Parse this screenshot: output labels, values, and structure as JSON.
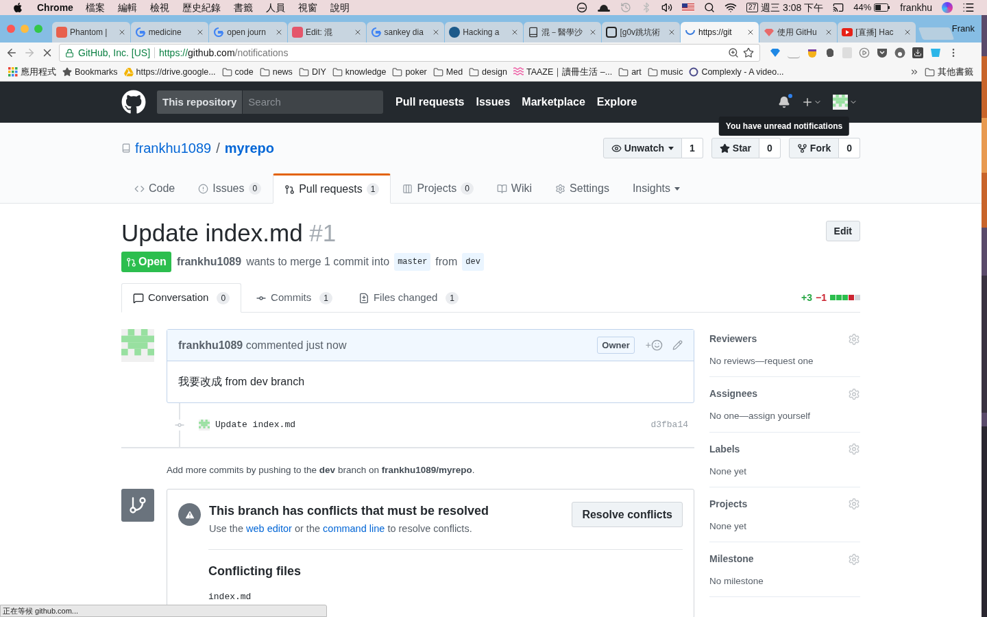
{
  "menubar": {
    "app": "Chrome",
    "menus": [
      "檔案",
      "編輯",
      "檢視",
      "歷史紀錄",
      "書籤",
      "人員",
      "視窗",
      "說明"
    ],
    "date_badge": "27",
    "clock": "週三 3:08 下午",
    "battery": "44%",
    "user": "frankhu"
  },
  "tabs": [
    {
      "title": "Phantom |",
      "kind": "red-square",
      "selected": false
    },
    {
      "title": "medicine",
      "kind": "google",
      "selected": false
    },
    {
      "title": "open journ",
      "kind": "google",
      "selected": false
    },
    {
      "title": "Edit: 混",
      "kind": "pink-square",
      "selected": false
    },
    {
      "title": "sankey dia",
      "kind": "google",
      "selected": false
    },
    {
      "title": "Hacking a",
      "kind": "globe",
      "selected": false
    },
    {
      "title": "混－醫學沙",
      "kind": "doc",
      "selected": false
    },
    {
      "title": "[g0v跳坑術",
      "kind": "framed",
      "selected": false
    },
    {
      "title": "https://git",
      "kind": "spinner",
      "selected": true
    },
    {
      "title": "使用 GitHu",
      "kind": "gem",
      "selected": false
    },
    {
      "title": "[直播] Hac",
      "kind": "play",
      "selected": false
    }
  ],
  "profile": "Frank",
  "address": {
    "secure_label": "GitHub, Inc. [US]",
    "scheme": "https://",
    "host": "github.com",
    "path": "/notifications"
  },
  "bookmarks": [
    {
      "label": "應用程式",
      "kind": "apps"
    },
    {
      "label": "Bookmarks",
      "kind": "star"
    },
    {
      "label": "https://drive.google...",
      "kind": "drive"
    },
    {
      "label": "code",
      "kind": "folder"
    },
    {
      "label": "news",
      "kind": "folder"
    },
    {
      "label": "DIY",
      "kind": "folder"
    },
    {
      "label": "knowledge",
      "kind": "folder"
    },
    {
      "label": "poker",
      "kind": "folder"
    },
    {
      "label": "Med",
      "kind": "folder"
    },
    {
      "label": "design",
      "kind": "folder"
    },
    {
      "label": "TAAZE｜讀冊生活 –...",
      "kind": "wave"
    },
    {
      "label": "art",
      "kind": "folder"
    },
    {
      "label": "music",
      "kind": "folder"
    },
    {
      "label": "Complexly - A video...",
      "kind": "ring"
    }
  ],
  "other_bookmarks": "其他書籤",
  "github": {
    "scope": "This repository",
    "search_placeholder": "Search",
    "nav": [
      "Pull requests",
      "Issues",
      "Marketplace",
      "Explore"
    ],
    "unread": true,
    "tooltip": "You have unread notifications"
  },
  "repo": {
    "owner": "frankhu1089",
    "separator": "/",
    "name": "myrepo",
    "actions": [
      {
        "label": "Unwatch",
        "kind": "eye",
        "dropdown": true,
        "count": "1"
      },
      {
        "label": "Star",
        "kind": "star",
        "dropdown": false,
        "count": "0"
      },
      {
        "label": "Fork",
        "kind": "fork",
        "dropdown": false,
        "count": "0"
      }
    ],
    "tabs": [
      {
        "label": "Code",
        "kind": "code",
        "selected": false,
        "dropdown": false
      },
      {
        "label": "Issues",
        "kind": "issue",
        "count": "0",
        "selected": false,
        "dropdown": false
      },
      {
        "label": "Pull requests",
        "kind": "pr",
        "count": "1",
        "selected": true,
        "dropdown": false
      },
      {
        "label": "Projects",
        "kind": "project",
        "count": "0",
        "selected": false,
        "dropdown": false
      },
      {
        "label": "Wiki",
        "kind": "wiki",
        "selected": false,
        "dropdown": false
      },
      {
        "label": "Settings",
        "kind": "gear",
        "selected": false,
        "dropdown": false
      },
      {
        "label": "Insights",
        "kind": "none",
        "selected": false,
        "dropdown": true
      }
    ]
  },
  "pr": {
    "title": "Update index.md",
    "number": "#1",
    "edit": "Edit",
    "state": "Open",
    "author": "frankhu1089",
    "merge_text": "wants to merge 1 commit into",
    "base": "master",
    "from_text": "from",
    "head": "dev",
    "tabs": [
      {
        "label": "Conversation",
        "kind": "comment",
        "count": "0",
        "selected": true
      },
      {
        "label": "Commits",
        "kind": "commit",
        "count": "1",
        "selected": false
      },
      {
        "label": "Files changed",
        "kind": "diff",
        "count": "1",
        "selected": false
      }
    ],
    "diffstat": {
      "added": "+3",
      "removed": "−1",
      "blocks": [
        {
          "color": "#2cbe4e"
        },
        {
          "color": "#2cbe4e"
        },
        {
          "color": "#2cbe4e"
        },
        {
          "color": "#cb2431"
        },
        {
          "color": "#d1d5da"
        }
      ]
    }
  },
  "comment": {
    "author": "frankhu1089",
    "action": "commented just now",
    "badge": "Owner",
    "reaction": "+",
    "body": "我要改成 from dev branch"
  },
  "commit": {
    "message": "Update index.md",
    "sha": "d3fba14"
  },
  "push_note": "Add more commits by pushing to the **dev** branch on **frankhu1089/myrepo**.",
  "merge_box": {
    "title": "This branch has conflicts that must be resolved",
    "text": [
      {
        "text": "Use the",
        "link": false
      },
      {
        "text": "web editor",
        "link": true
      },
      {
        "text": "or the",
        "link": false
      },
      {
        "text": "command line",
        "link": true
      },
      {
        "text": "to resolve conflicts.",
        "link": false
      }
    ],
    "button": "Resolve conflicts",
    "files_heading": "Conflicting files",
    "files": [
      "index.md"
    ]
  },
  "sidebar": [
    {
      "heading": "Reviewers",
      "value": "No reviews—request one"
    },
    {
      "heading": "Assignees",
      "value": "No one—assign yourself"
    },
    {
      "heading": "Labels",
      "value": "None yet"
    },
    {
      "heading": "Projects",
      "value": "None yet"
    },
    {
      "heading": "Milestone",
      "value": "No milestone"
    }
  ],
  "status_bubble": "正在等候 github.com..."
}
